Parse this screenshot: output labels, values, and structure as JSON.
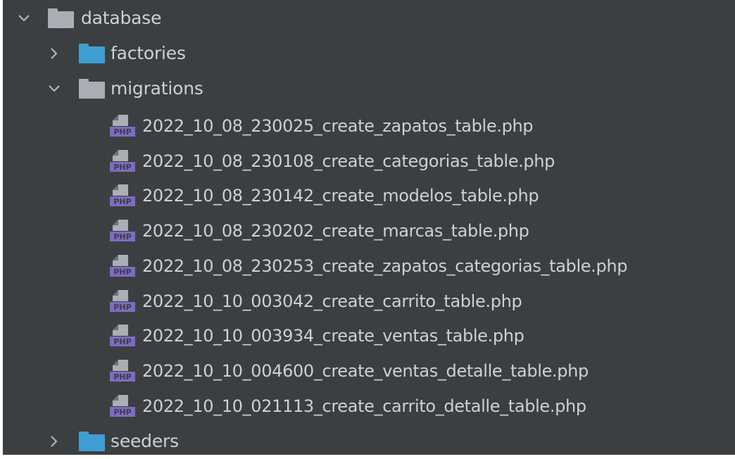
{
  "colors": {
    "panel_bg": "#3c3f41",
    "text": "#cdd1d4",
    "folder_gray": "#a9afb4",
    "folder_blue": "#3f9fd3",
    "php_purple": "#7e6bc5",
    "chevron": "#b7bcc0"
  },
  "tree": {
    "database": {
      "label": "database",
      "expanded": true,
      "icon": "folder-gray-icon"
    },
    "factories": {
      "label": "factories",
      "expanded": false,
      "icon": "folder-blue-icon"
    },
    "migrations": {
      "label": "migrations",
      "expanded": true,
      "icon": "folder-gray-icon"
    },
    "files": [
      {
        "label": "2022_10_08_230025_create_zapatos_table.php",
        "icon": "php-file-icon"
      },
      {
        "label": "2022_10_08_230108_create_categorias_table.php",
        "icon": "php-file-icon"
      },
      {
        "label": "2022_10_08_230142_create_modelos_table.php",
        "icon": "php-file-icon"
      },
      {
        "label": "2022_10_08_230202_create_marcas_table.php",
        "icon": "php-file-icon"
      },
      {
        "label": "2022_10_08_230253_create_zapatos_categorias_table.php",
        "icon": "php-file-icon"
      },
      {
        "label": "2022_10_10_003042_create_carrito_table.php",
        "icon": "php-file-icon"
      },
      {
        "label": "2022_10_10_003934_create_ventas_table.php",
        "icon": "php-file-icon"
      },
      {
        "label": "2022_10_10_004600_create_ventas_detalle_table.php",
        "icon": "php-file-icon"
      },
      {
        "label": "2022_10_10_021113_create_carrito_detalle_table.php",
        "icon": "php-file-icon"
      }
    ],
    "seeders": {
      "label": "seeders",
      "expanded": false,
      "icon": "folder-blue-icon"
    }
  }
}
